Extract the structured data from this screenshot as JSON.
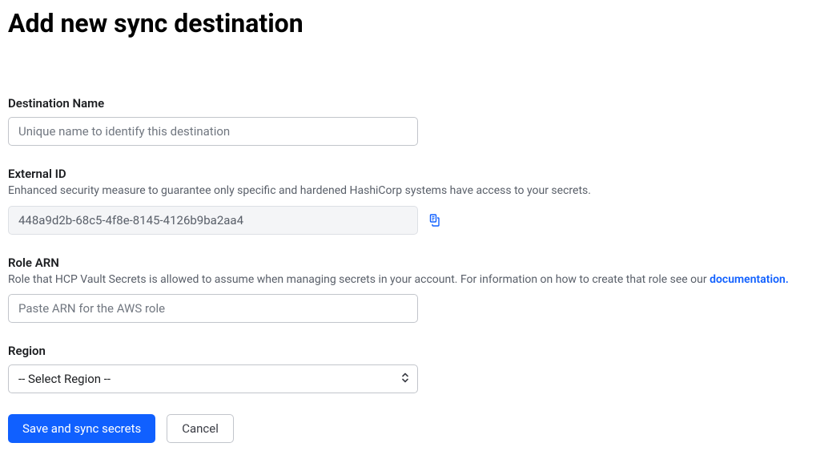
{
  "page": {
    "title": "Add new sync destination"
  },
  "fields": {
    "destinationName": {
      "label": "Destination Name",
      "placeholder": "Unique name to identify this destination",
      "value": ""
    },
    "externalId": {
      "label": "External ID",
      "help": "Enhanced security measure to guarantee only specific and hardened HashiCorp systems have access to your secrets.",
      "value": "448a9d2b-68c5-4f8e-8145-4126b9ba2aa4"
    },
    "roleArn": {
      "label": "Role ARN",
      "helpPrefix": "Role that HCP Vault Secrets is allowed to assume when managing secrets in your account. For information on how to create that role see our ",
      "helpLinkText": "documentation.",
      "placeholder": "Paste ARN for the AWS role",
      "value": ""
    },
    "region": {
      "label": "Region",
      "placeholder": "-- Select Region --",
      "value": ""
    }
  },
  "buttons": {
    "save": "Save and sync secrets",
    "cancel": "Cancel"
  }
}
